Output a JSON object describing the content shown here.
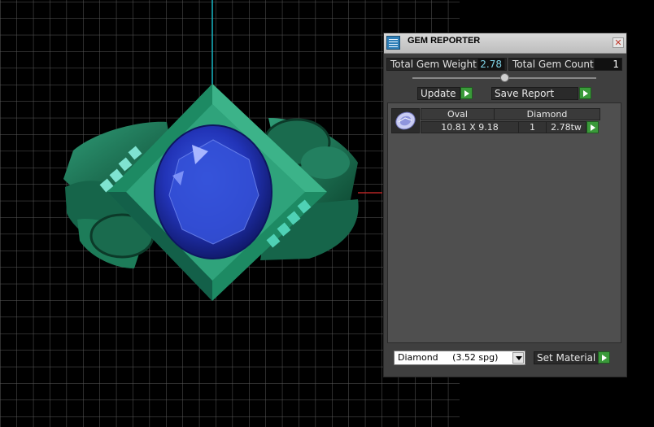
{
  "window": {
    "title": "GEM REPORTER",
    "close_glyph": "✕"
  },
  "summary": {
    "weight_label": "Total Gem Weight",
    "weight_value": "2.78",
    "count_label": "Total Gem Count",
    "count_value": "1"
  },
  "actions": {
    "update_label": "Update",
    "save_label": "Save Report"
  },
  "report": {
    "columns": [
      "Oval",
      "Diamond"
    ],
    "rows": [
      {
        "size": "10.81 X 9.18",
        "count": "1",
        "weight": "2.78tw"
      }
    ]
  },
  "material": {
    "selected": "Diamond     (3.52 spg)",
    "set_label": "Set Material"
  },
  "icons": {
    "app": "gem-reporter-icon",
    "close": "close-icon",
    "play": "play-icon",
    "dropdown": "chevron-down-icon",
    "gem_thumb": "oval-gem-icon"
  },
  "colors": {
    "accent_green": "#3a9a3a",
    "value_cyan": "#7fd3e6",
    "gem_blue": "#2a40c8",
    "ring_green": "#1f7d5c"
  }
}
